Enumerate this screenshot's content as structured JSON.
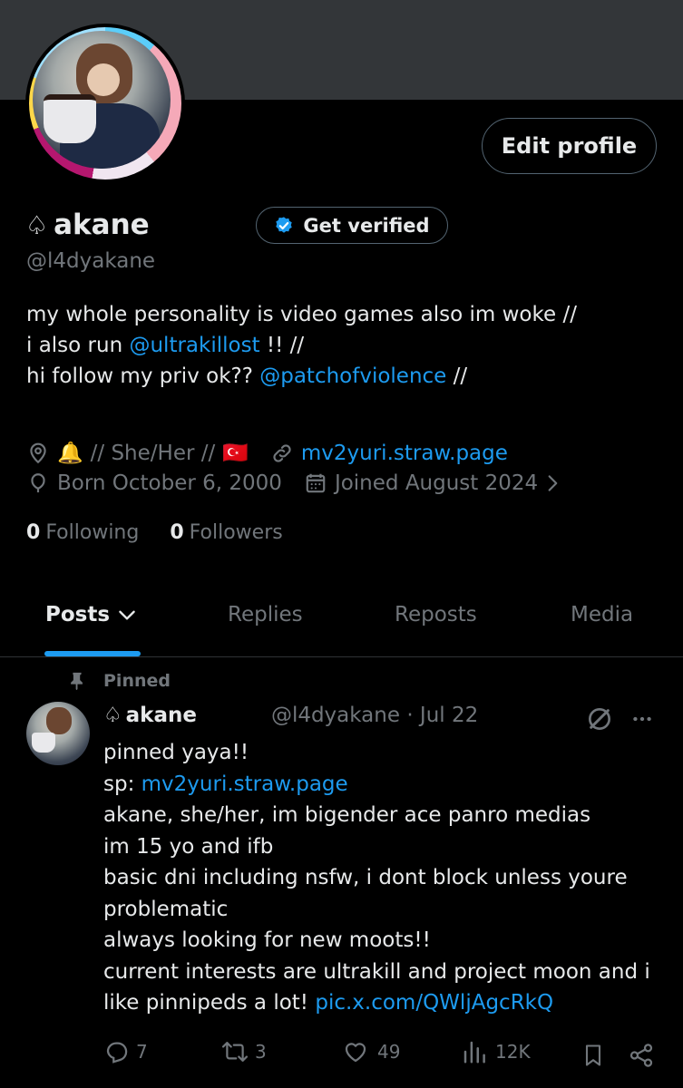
{
  "profile": {
    "name": "akane",
    "name_glyph": "♤",
    "handle": "@l4dyakane",
    "edit_label": "Edit profile",
    "verify_label": "Get verified",
    "bio": {
      "line1": "my whole personality is video games also im woke //",
      "line2_pre": "i also run ",
      "line2_link": "@ultrakillost",
      "line2_post": " !! //",
      "line3_pre": "hi follow my priv ok?? ",
      "line3_link": "@patchofviolence",
      "line3_post": " //"
    },
    "location_emoji": "🔔",
    "location_text": "// She/Her //",
    "flag_emoji": "🇹🇷",
    "website": "mv2yuri.straw.page",
    "born": "Born October 6, 2000",
    "joined": "Joined August 2024",
    "following_count": "0",
    "following_label": "Following",
    "followers_count": "0",
    "followers_label": "Followers"
  },
  "tabs": [
    "Posts",
    "Replies",
    "Reposts",
    "Media"
  ],
  "post": {
    "pinned_label": "Pinned",
    "name": "akane",
    "name_glyph": "♤",
    "handle_date": "@l4dyakane · Jul 22",
    "lines": {
      "l1": "pinned yaya!!",
      "l2_pre": "sp: ",
      "l2_link": "mv2yuri.straw.page",
      "l3": "akane, she/her, im bigender ace panro medias",
      "l4": "im 15 yo and ifb",
      "l5": "basic dni including nsfw, i dont block unless youre",
      "l6": "problematic",
      "l7": "always looking for new moots!!",
      "l8": "current interests are ultrakill and project moon and i",
      "l9_pre": "like pinnipeds a lot! ",
      "l9_link": "pic.x.com/QWljAgcRkQ"
    },
    "replies": "7",
    "reposts": "3",
    "likes": "49",
    "views": "12K"
  },
  "colors": {
    "background": "#000000",
    "banner": "#333639",
    "text": "#e7e9ea",
    "muted": "#71767b",
    "accent": "#1d9bf0",
    "border": "#536471"
  },
  "icons": [
    "location-icon",
    "link-icon",
    "balloon-icon",
    "calendar-icon",
    "chevron-right-icon",
    "chevron-down-icon",
    "pin-icon",
    "grok-icon",
    "more-icon",
    "reply-icon",
    "repost-icon",
    "like-icon",
    "views-icon",
    "bookmark-icon",
    "share-icon",
    "verified-badge-icon"
  ]
}
